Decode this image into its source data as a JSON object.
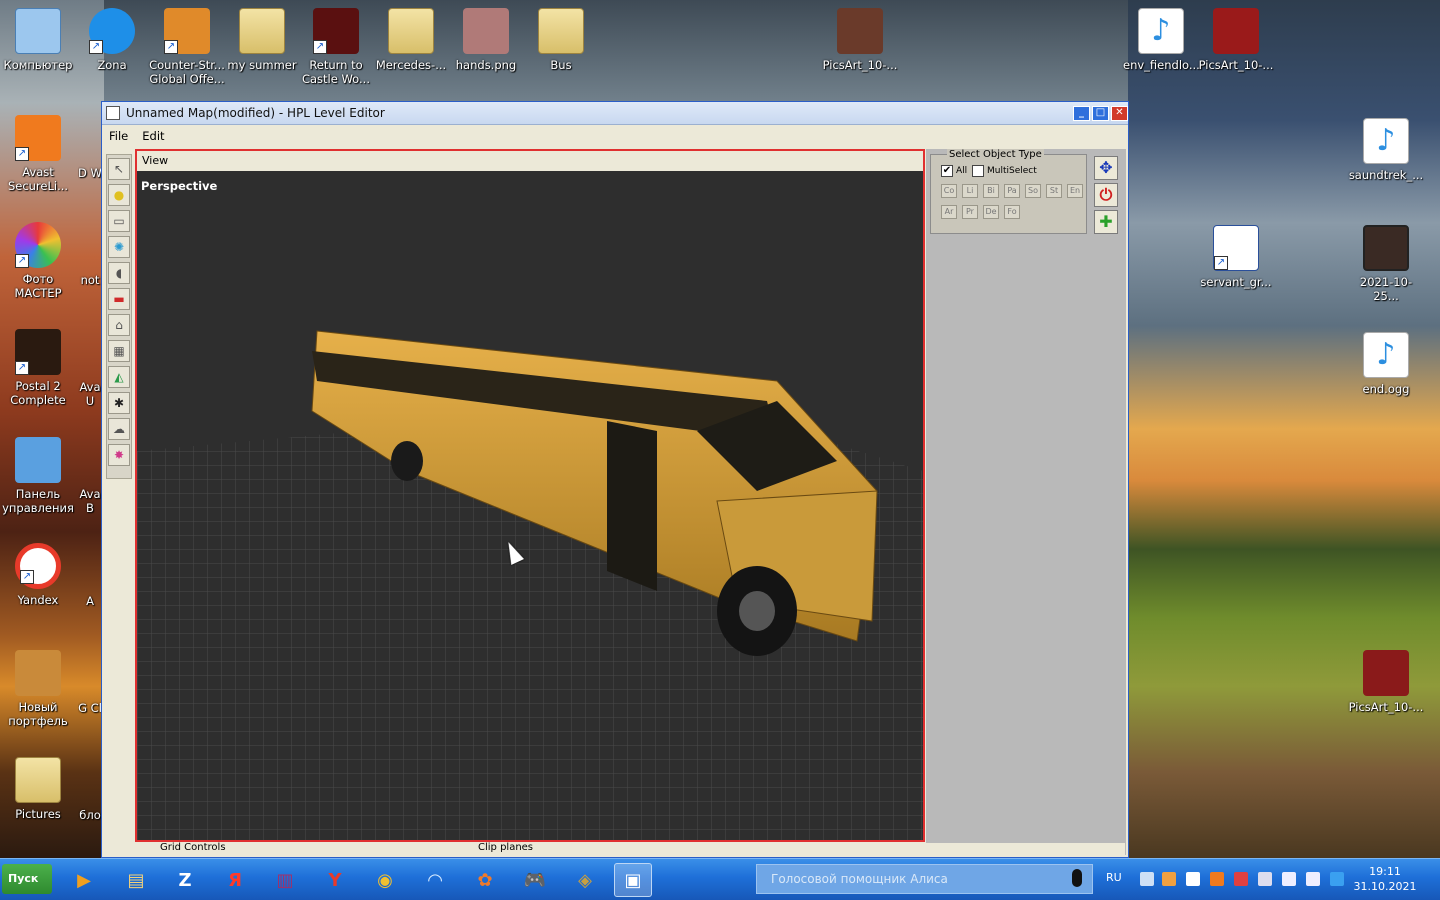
{
  "desktop": {
    "icons_top": [
      {
        "label": "Компьютер",
        "icon": "computer-icon"
      },
      {
        "label": "Zona",
        "icon": "zona-icon"
      },
      {
        "label": "Counter-Str... Global Offe...",
        "icon": "csgo-icon"
      },
      {
        "label": "my summer",
        "icon": "folder-icon"
      },
      {
        "label": "Return to Castle Wo...",
        "icon": "rtcw-icon"
      },
      {
        "label": "Mercedes-...",
        "icon": "zip-folder-icon"
      },
      {
        "label": "hands.png",
        "icon": "image-icon"
      },
      {
        "label": "Bus",
        "icon": "folder-icon"
      },
      {
        "label": "PicsArt_10-...",
        "icon": "image-icon"
      },
      {
        "label": "env_fiendlo...",
        "icon": "music-icon"
      },
      {
        "label": "PicsArt_10-...",
        "icon": "image-icon"
      }
    ],
    "icons_left": [
      {
        "label": "Avast SecureLi...",
        "icon": "avast-secureline-icon"
      },
      {
        "label": "Фото МАСТЕР",
        "icon": "photo-master-icon"
      },
      {
        "label": "Postal 2 Complete",
        "icon": "postal2-icon"
      },
      {
        "label": "Панель управления",
        "icon": "control-panel-icon"
      },
      {
        "label": "Yandex",
        "icon": "yandex-browser-icon"
      },
      {
        "label": "Новый портфель",
        "icon": "briefcase-icon"
      },
      {
        "label": "Pictures",
        "icon": "folder-icon"
      }
    ],
    "icons_left_partial": [
      "D W",
      "not",
      "Ava U",
      "Ava B",
      "A",
      "G Cl",
      "бло"
    ],
    "icons_right": [
      {
        "label": "saundtrek_...",
        "icon": "mp3-icon"
      },
      {
        "label": "servant_gr...",
        "icon": "spreadsheet-icon"
      },
      {
        "label": "2021-10-25...",
        "icon": "video-icon"
      },
      {
        "label": "end.ogg",
        "icon": "music-icon"
      },
      {
        "label": "PicsArt_10-...",
        "icon": "image-icon"
      }
    ]
  },
  "window": {
    "title": "Unnamed Map(modified) - HPL Level Editor",
    "menu": [
      "File",
      "Edit"
    ],
    "view_header": "View",
    "viewport_label": "Perspective",
    "tools": [
      "select-tool-icon",
      "light-tool-icon",
      "billboard-tool-icon",
      "particle-tool-icon",
      "sound-tool-icon",
      "static-object-tool-icon",
      "entity-tool-icon",
      "area-tool-icon",
      "primitive-tool-icon",
      "decal-tool-icon",
      "fog-tool-icon",
      "combine-tool-icon"
    ],
    "select_object_type": {
      "title": "Select Object Type",
      "all_label": "All",
      "all_checked": true,
      "multiselect_label": "MultiSelect",
      "multiselect_checked": false,
      "types_row1": [
        "Co",
        "Li",
        "Bi",
        "Pa",
        "So",
        "St",
        "En"
      ],
      "types_row2": [
        "Ar",
        "Pr",
        "De",
        "Fo"
      ]
    },
    "bottom": {
      "grid_controls": "Grid Controls",
      "clip_planes": "Clip planes"
    }
  },
  "taskbar": {
    "start_label": "Пуск",
    "search_placeholder": "Голосовой помощник Алиса",
    "language": "RU",
    "time": "19:11",
    "date": "31.10.2021"
  },
  "colors": {
    "viewport_border": "#e03030",
    "taskbar": "#1e6fd8",
    "selection_accent": "#2a5ec8"
  }
}
